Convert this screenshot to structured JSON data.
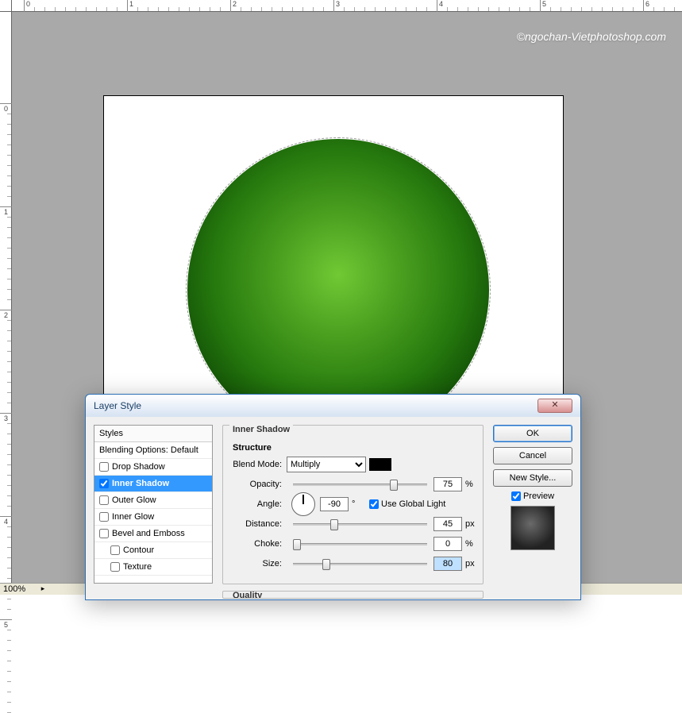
{
  "ruler": {
    "top_marks": [
      "0",
      "1",
      "2",
      "3",
      "4",
      "5",
      "6"
    ],
    "left_marks": [
      "0",
      "1",
      "2",
      "3",
      "4",
      "5"
    ]
  },
  "workspace": {
    "watermark": "©ngochan-Vietphotoshop.com"
  },
  "status": {
    "zoom": "100%"
  },
  "dialog": {
    "title": "Layer Style",
    "close_glyph": "✕",
    "styles_header": "Styles",
    "styles": [
      {
        "label": "Blending Options: Default",
        "checked": null,
        "selected": false
      },
      {
        "label": "Drop Shadow",
        "checked": false,
        "selected": false
      },
      {
        "label": "Inner Shadow",
        "checked": true,
        "selected": true
      },
      {
        "label": "Outer Glow",
        "checked": false,
        "selected": false
      },
      {
        "label": "Inner Glow",
        "checked": false,
        "selected": false
      },
      {
        "label": "Bevel and Emboss",
        "checked": false,
        "selected": false
      },
      {
        "label": "Contour",
        "checked": false,
        "selected": false,
        "indent": true
      },
      {
        "label": "Texture",
        "checked": false,
        "selected": false,
        "indent": true
      }
    ],
    "section_title": "Inner Shadow",
    "structure_title": "Structure",
    "blend_mode_label": "Blend Mode:",
    "blend_mode_value": "Multiply",
    "shadow_color": "#000000",
    "opacity_label": "Opacity:",
    "opacity_value": "75",
    "opacity_unit": "%",
    "angle_label": "Angle:",
    "angle_value": "-90",
    "angle_unit": "°",
    "global_light_label": "Use Global Light",
    "global_light_checked": true,
    "distance_label": "Distance:",
    "distance_value": "45",
    "distance_unit": "px",
    "choke_label": "Choke:",
    "choke_value": "0",
    "choke_unit": "%",
    "size_label": "Size:",
    "size_value": "80",
    "size_unit": "px",
    "quality_title": "Quality",
    "ok_label": "OK",
    "cancel_label": "Cancel",
    "new_style_label": "New Style...",
    "preview_label": "Preview",
    "preview_checked": true
  }
}
